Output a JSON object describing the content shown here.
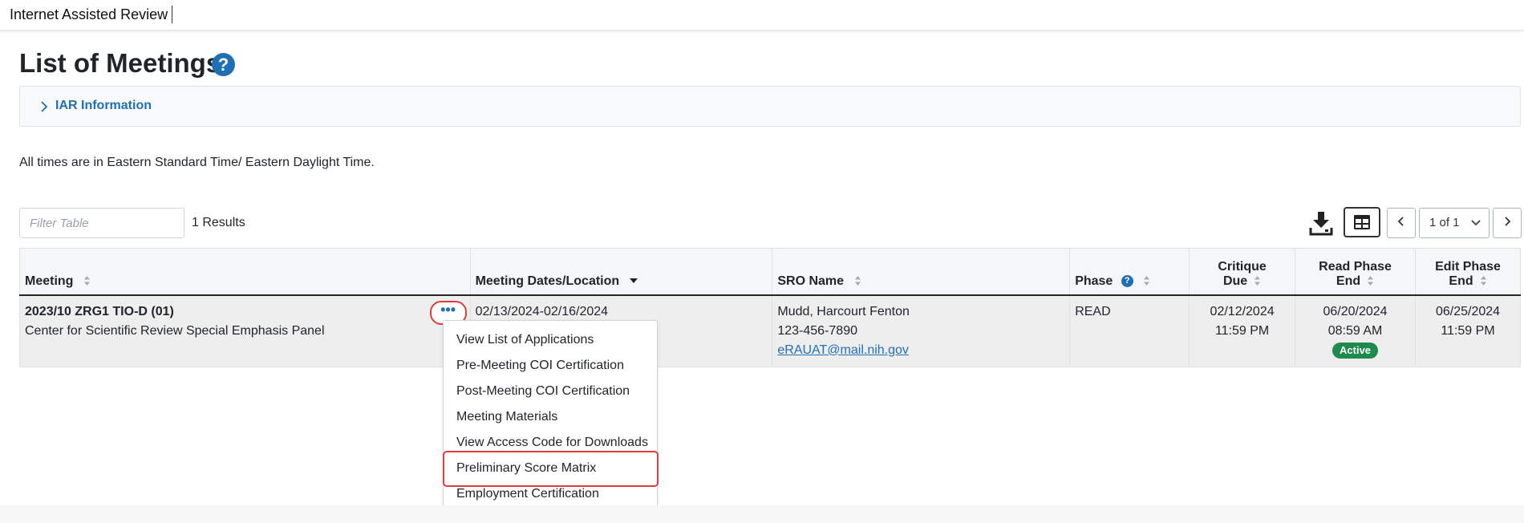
{
  "app": {
    "title": "Internet Assisted Review"
  },
  "page": {
    "title": "List of Meetings"
  },
  "iar_panel": {
    "label": "IAR Information"
  },
  "timezone_note": "All times are in Eastern Standard Time/ Eastern Daylight Time.",
  "filter": {
    "placeholder": "Filter Table"
  },
  "results_text": "1 Results",
  "pagination": {
    "current": "1 of 1"
  },
  "table": {
    "headers": {
      "meeting": "Meeting",
      "dates_location": "Meeting Dates/Location",
      "sro_name": "SRO Name",
      "phase": "Phase",
      "critique_due_1": "Critique",
      "critique_due_2": "Due",
      "read_phase_end_1": "Read Phase",
      "read_phase_end_2": "End",
      "edit_phase_end_1": "Edit Phase",
      "edit_phase_end_2": "End"
    },
    "rows": [
      {
        "meeting_code": "2023/10 ZRG1 TIO-D (01)",
        "meeting_name": "Center for Scientific Review Special Emphasis Panel",
        "dates": "02/13/2024-02/16/2024",
        "sro_name": "Mudd, Harcourt Fenton",
        "sro_phone": "123-456-7890",
        "sro_email": "eRAUAT@mail.nih.gov",
        "phase": "READ",
        "critique_due_date": "02/12/2024",
        "critique_due_time": "11:59 PM",
        "read_end_date": "06/20/2024",
        "read_end_time": "08:59 AM",
        "read_status": "Active",
        "edit_end_date": "06/25/2024",
        "edit_end_time": "11:59 PM"
      }
    ]
  },
  "row_menu": {
    "button_label": "•••",
    "items": [
      "View List of Applications",
      "Pre-Meeting COI Certification",
      "Post-Meeting COI Certification",
      "Meeting Materials",
      "View Access Code for Downloads",
      "Preliminary Score Matrix",
      "Employment Certification"
    ],
    "highlighted_item": "Preliminary Score Matrix"
  },
  "colors": {
    "link_blue": "#1f6fb5",
    "highlight_red": "#e03c3c",
    "active_green": "#1e8a4c"
  }
}
